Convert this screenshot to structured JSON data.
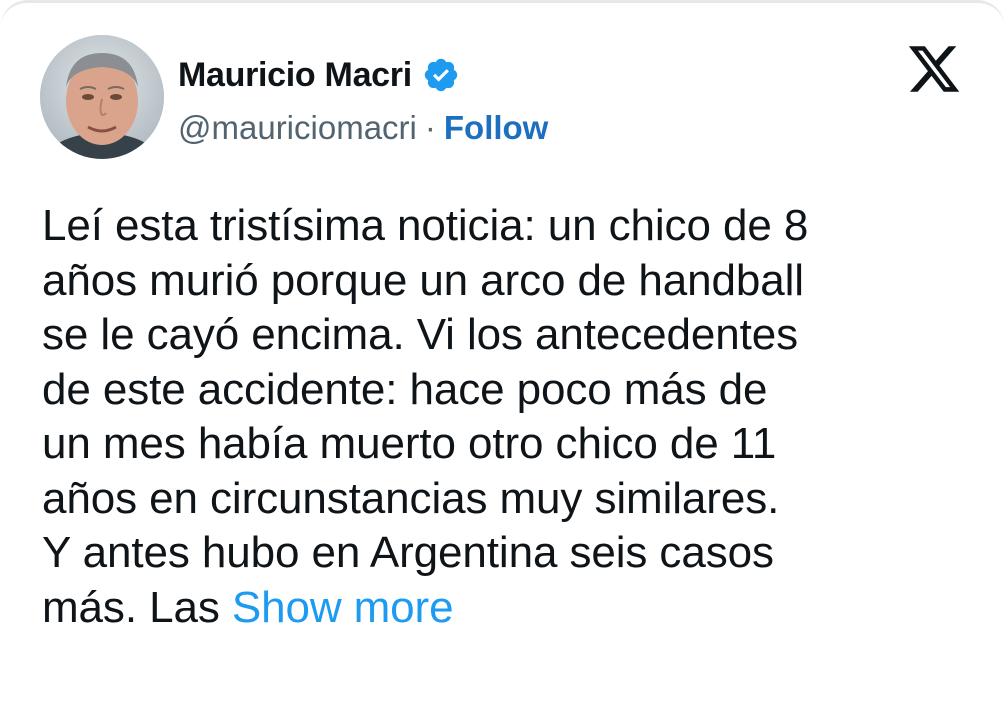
{
  "tweet": {
    "author": {
      "display_name": "Mauricio Macri",
      "handle": "@mauriciomacri",
      "verified": true,
      "separator": "·",
      "follow_label": "Follow"
    },
    "platform_icon": "x-logo-icon",
    "text_lines": [
      "Leí esta tristísima noticia: un chico de 8",
      "años murió porque un arco de handball",
      "se le cayó encima. Vi los antecedentes",
      "de este accidente: hace poco más de",
      "un mes había muerto otro chico de 11",
      "años en circunstancias muy similares.",
      "Y antes hubo en Argentina seis casos"
    ],
    "last_line_text": "más. Las ",
    "show_more_label": "Show more"
  },
  "colors": {
    "text": "#0f1419",
    "secondary": "#536471",
    "follow": "#1d6fbf",
    "link": "#1d9bf0",
    "verified": "#1d9bf0"
  }
}
